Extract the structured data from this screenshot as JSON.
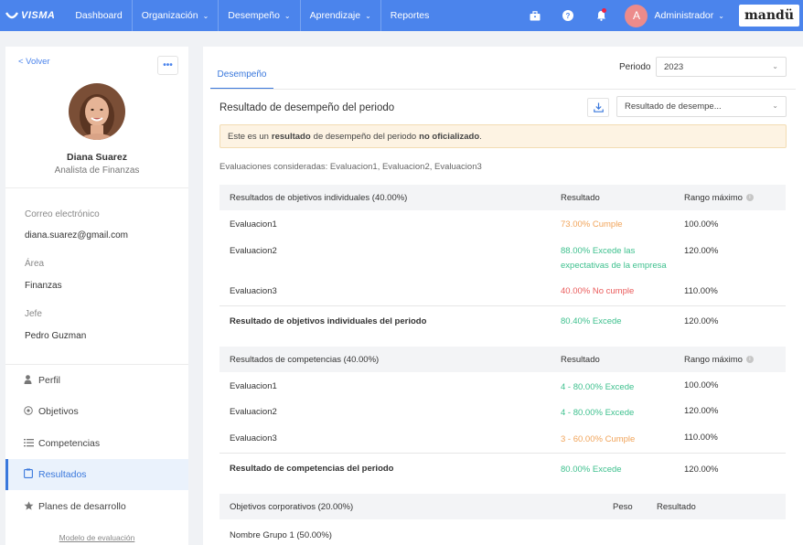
{
  "topbar": {
    "logo_text": "VISMA",
    "nav": [
      {
        "label": "Dashboard"
      },
      {
        "label": "Organización"
      },
      {
        "label": "Desempeño"
      },
      {
        "label": "Aprendizaje"
      },
      {
        "label": "Reportes"
      }
    ],
    "user_initial": "A",
    "user_name": "Administrador",
    "brand": "mandü",
    "accent": "#4b84ec"
  },
  "sidebar": {
    "back": "< Volver",
    "more": "•••",
    "name": "Diana Suarez",
    "role": "Analista de Finanzas",
    "fields": [
      {
        "label": "Correo electrónico",
        "value": "diana.suarez@gmail.com"
      },
      {
        "label": "Área",
        "value": "Finanzas"
      },
      {
        "label": "Jefe",
        "value": "Pedro Guzman"
      }
    ],
    "menu": [
      {
        "label": "Perfil",
        "icon": "person-icon"
      },
      {
        "label": "Objetivos",
        "icon": "target-icon"
      },
      {
        "label": "Competencias",
        "icon": "list-icon"
      },
      {
        "label": "Resultados",
        "icon": "clipboard-icon"
      },
      {
        "label": "Planes de desarrollo",
        "icon": "star-icon"
      }
    ],
    "footer": "Modelo de evaluación"
  },
  "main": {
    "tab": "Desempeño",
    "periodo_label": "Periodo",
    "periodo_value": "2023",
    "title": "Resultado de desempeño del periodo",
    "result_select": "Resultado de desempe...",
    "alert": {
      "p1": "Este es un",
      "b1": "resultado",
      "p2": "de desempeño del periodo",
      "b2": "no oficializado",
      "p3": "."
    },
    "evals": "Evaluaciones consideradas: Evaluacion1, Evaluacion2, Evaluacion3",
    "objetivos": {
      "header": "Resultados de objetivos individuales (40.00%)",
      "col_result": "Resultado",
      "col_range": "Rango máximo",
      "rows": [
        {
          "name": "Evaluacion1",
          "result": "73.00% Cumple",
          "range": "100.00%"
        },
        {
          "name": "Evaluacion2",
          "result_l1": "88.00% Excede las",
          "result_l2": "expectativas de la empresa",
          "range": "120.00%"
        },
        {
          "name": "Evaluacion3",
          "result": "40.00% No cumple",
          "range": "110.00%"
        }
      ],
      "total": {
        "name": "Resultado de objetivos individuales del periodo",
        "result": "80.40% Excede",
        "range": "120.00%"
      }
    },
    "competencias": {
      "header": "Resultados de competencias (40.00%)",
      "col_result": "Resultado",
      "col_range": "Rango máximo",
      "rows": [
        {
          "name": "Evaluacion1",
          "result": "4 - 80.00% Excede",
          "range": "100.00%"
        },
        {
          "name": "Evaluacion2",
          "result": "4 - 80.00% Excede",
          "range": "120.00%"
        },
        {
          "name": "Evaluacion3",
          "result": "3 - 60.00% Cumple",
          "range": "110.00%"
        }
      ],
      "total": {
        "name": "Resultado de competencias del periodo",
        "result": "80.00% Excede",
        "range": "120.00%"
      }
    },
    "corporativos": {
      "header": "Objetivos corporativos (20.00%)",
      "col_peso": "Peso",
      "col_result": "Resultado",
      "group": "Nombre Grupo 1 (50.00%)"
    }
  }
}
